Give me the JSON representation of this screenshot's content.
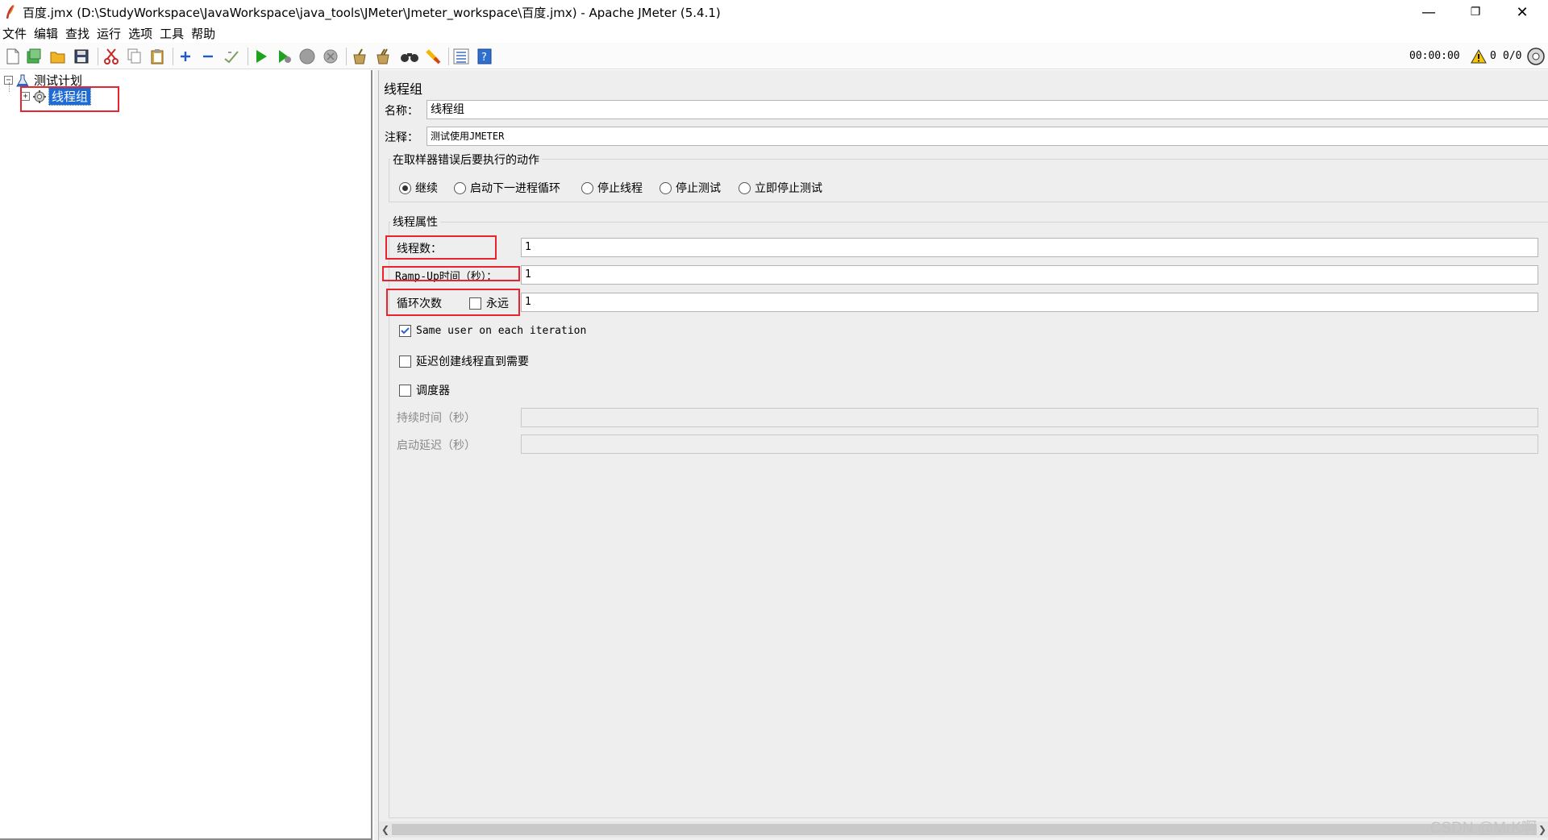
{
  "window": {
    "title": "百度.jmx (D:\\StudyWorkspace\\JavaWorkspace\\java_tools\\JMeter\\Jmeter_workspace\\百度.jmx) - Apache JMeter (5.4.1)",
    "minimize": "—",
    "restore": "❐",
    "close": "✕"
  },
  "menu": [
    "文件",
    "编辑",
    "查找",
    "运行",
    "选项",
    "工具",
    "帮助"
  ],
  "toolbar": {
    "icons": [
      "new-icon",
      "templates-icon",
      "open-icon",
      "save-icon",
      "cut-icon",
      "copy-icon",
      "paste-icon",
      "expand-icon",
      "collapse-icon",
      "toggle-icon",
      "start-icon",
      "start-no-pause-icon",
      "stop-icon",
      "shutdown-icon",
      "clear-icon",
      "clear-all-icon",
      "search-icon",
      "reset-search-icon",
      "function-helper-icon",
      "help-icon"
    ],
    "elapsed_time": "00:00:00",
    "warning_count": "0",
    "thread_count": "0/0"
  },
  "tree": {
    "root": "测试计划",
    "child": "线程组"
  },
  "panel": {
    "title": "线程组",
    "name_label": "名称：",
    "name_value": "线程组",
    "comment_label": "注释：",
    "comment_value": "测试使用JMETER",
    "error_action_legend": "在取样器错误后要执行的动作",
    "error_actions": [
      {
        "label": "继续",
        "selected": true
      },
      {
        "label": "启动下一进程循环",
        "selected": false
      },
      {
        "label": "停止线程",
        "selected": false
      },
      {
        "label": "停止测试",
        "selected": false
      },
      {
        "label": "立即停止测试",
        "selected": false
      }
    ],
    "thread_props_legend": "线程属性",
    "threads_label": "线程数：",
    "threads_value": "1",
    "rampup_label": "Ramp-Up时间（秒）：",
    "rampup_value": "1",
    "loop_label": "循环次数",
    "forever_label": "永远",
    "forever_checked": false,
    "loop_value": "1",
    "same_user_label": "Same user on each iteration",
    "same_user_checked": true,
    "delay_create_label": "延迟创建线程直到需要",
    "delay_create_checked": false,
    "scheduler_label": "调度器",
    "scheduler_checked": false,
    "duration_label": "持续时间（秒）",
    "duration_value": "",
    "startup_delay_label": "启动延迟（秒）",
    "startup_delay_value": ""
  },
  "watermark": "CSDN @MrK啊"
}
